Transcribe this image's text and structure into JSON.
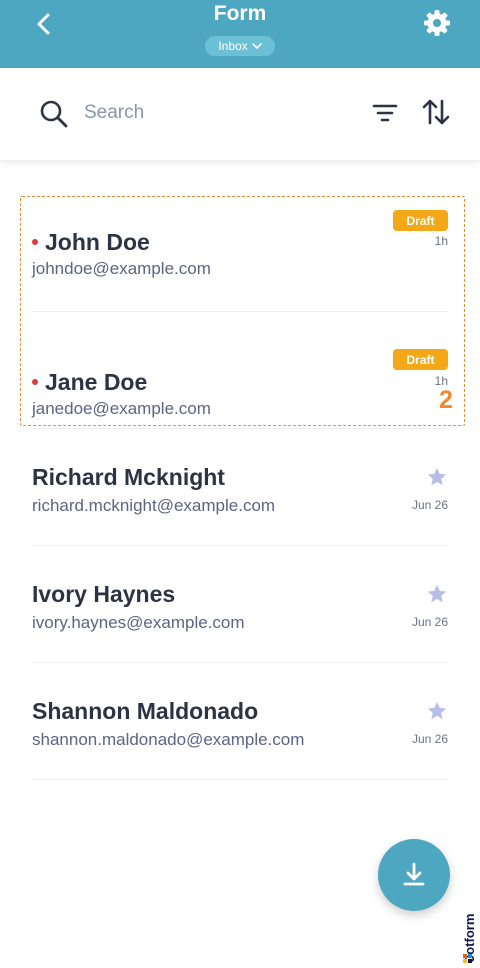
{
  "header": {
    "title": "Form",
    "inbox_label": "Inbox"
  },
  "search": {
    "placeholder": "Search"
  },
  "submissions": [
    {
      "name": "John Doe",
      "email": "johndoe@example.com",
      "badge": "Draft",
      "time": "1h",
      "unread": true
    },
    {
      "name": "Jane Doe",
      "email": "janedoe@example.com",
      "badge": "Draft",
      "time": "1h",
      "unread": true
    },
    {
      "name": "Richard Mcknight",
      "email": "richard.mcknight@example.com",
      "time": "Jun 26",
      "starred": false
    },
    {
      "name": "Ivory Haynes",
      "email": "ivory.haynes@example.com",
      "time": "Jun 26",
      "starred": false
    },
    {
      "name": "Shannon Maldonado",
      "email": "shannon.maldonado@example.com",
      "time": "Jun 26",
      "starred": false
    }
  ],
  "annotation": {
    "step_number": "2"
  },
  "brand": {
    "name": "Jotform"
  },
  "colors": {
    "header": "#4da7c0",
    "badge": "#f4a818",
    "unread_dot": "#e0393e",
    "highlight": "#f08a2e",
    "star": "#b7bde6"
  },
  "icons": [
    "back-arrow-icon",
    "chevron-down-icon",
    "gear-icon",
    "search-icon",
    "filter-icon",
    "sort-icon",
    "star-icon",
    "download-icon"
  ]
}
